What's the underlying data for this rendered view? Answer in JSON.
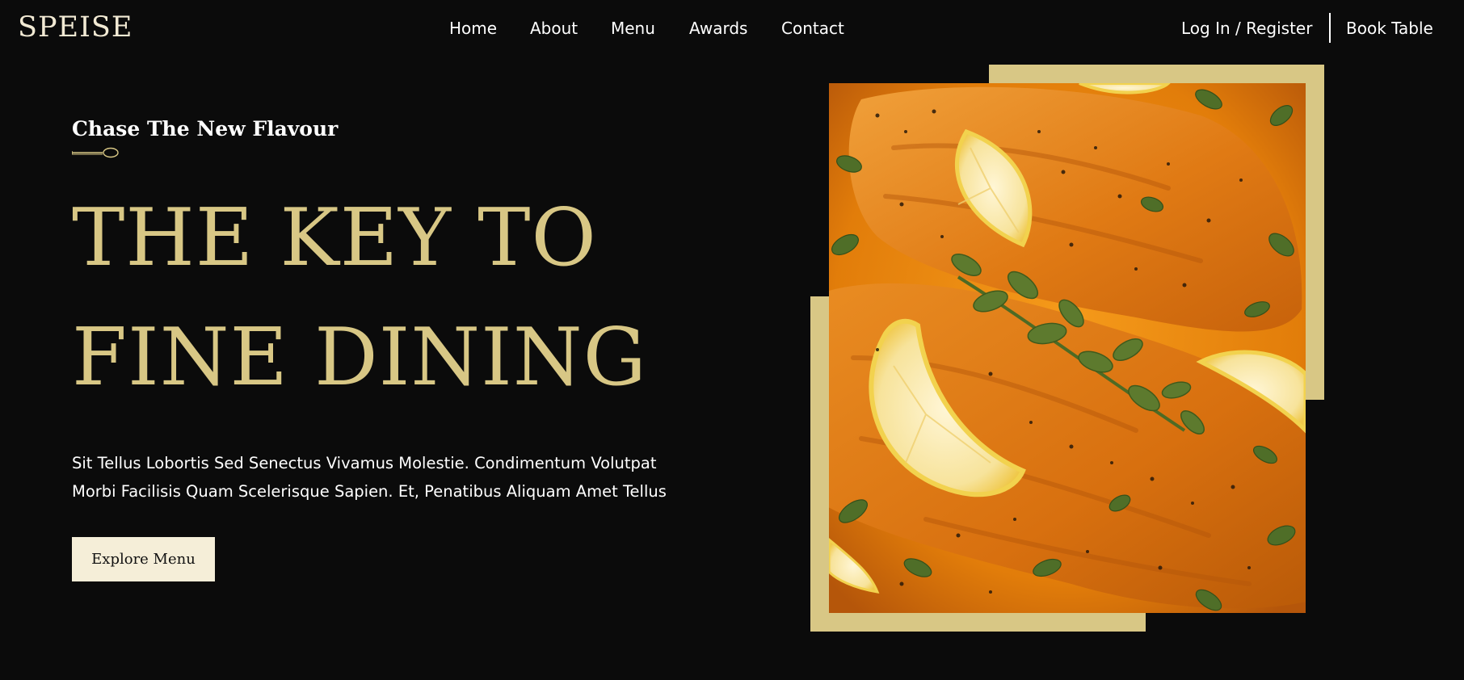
{
  "brand": {
    "logo": "SPEISE"
  },
  "nav": {
    "items": [
      {
        "label": "Home"
      },
      {
        "label": "About"
      },
      {
        "label": "Menu"
      },
      {
        "label": "Awards"
      },
      {
        "label": "Contact"
      }
    ],
    "login_label": "Log In / Register",
    "book_label": "Book Table"
  },
  "hero": {
    "tagline": "Chase The New Flavour",
    "headline_line1": "THE KEY TO",
    "headline_line2": "FINE DINING",
    "description_line1": "Sit Tellus Lobortis Sed Senectus Vivamus Molestie. Condimentum Volutpat",
    "description_line2": "Morbi Facilisis Quam Scelerisque Sapien. Et, Penatibus Aliquam Amet Tellus",
    "cta_label": "Explore Menu",
    "image_subject": "salmon-with-lemon-and-herbs"
  },
  "colors": {
    "background": "#0b0b0b",
    "accent_gold": "#d8c785",
    "button_cream": "#f5eed8",
    "text": "#ffffff"
  },
  "icons": {
    "divider_ornament": "spoon-icon"
  }
}
